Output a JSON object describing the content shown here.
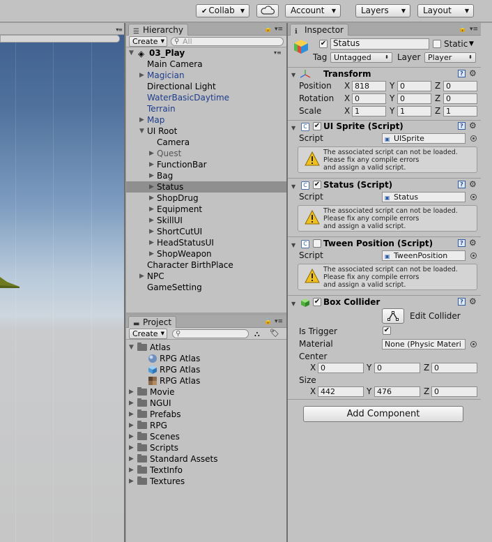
{
  "toolbar": {
    "collab": "Collab",
    "account": "Account",
    "layers": "Layers",
    "layout": "Layout"
  },
  "hierarchy": {
    "tab": "Hierarchy",
    "create": "Create",
    "search_placeholder": "All",
    "scene": "03_Play",
    "items": [
      {
        "label": "Main Camera"
      },
      {
        "label": "Magician"
      },
      {
        "label": "Directional Light"
      },
      {
        "label": "WaterBasicDaytime"
      },
      {
        "label": "Terrain"
      },
      {
        "label": "Map"
      },
      {
        "label": "UI Root"
      },
      {
        "label": "Camera"
      },
      {
        "label": "Quest"
      },
      {
        "label": "FunctionBar"
      },
      {
        "label": "Bag"
      },
      {
        "label": "Status"
      },
      {
        "label": "ShopDrug"
      },
      {
        "label": "Equipment"
      },
      {
        "label": "SkillUI"
      },
      {
        "label": "ShortCutUI"
      },
      {
        "label": "HeadStatusUI"
      },
      {
        "label": "ShopWeapon"
      },
      {
        "label": "Character BirthPlace"
      },
      {
        "label": "NPC"
      },
      {
        "label": "GameSetting"
      }
    ]
  },
  "project": {
    "tab": "Project",
    "create": "Create",
    "items": [
      {
        "label": "Atlas"
      },
      {
        "label": "RPG Atlas"
      },
      {
        "label": "RPG Atlas"
      },
      {
        "label": "RPG Atlas"
      },
      {
        "label": "Movie"
      },
      {
        "label": "NGUI"
      },
      {
        "label": "Prefabs"
      },
      {
        "label": "RPG"
      },
      {
        "label": "Scenes"
      },
      {
        "label": "Scripts"
      },
      {
        "label": "Standard Assets"
      },
      {
        "label": "TextInfo"
      },
      {
        "label": "Textures"
      }
    ]
  },
  "inspector": {
    "tab": "Inspector",
    "name": "Status",
    "static_label": "Static",
    "tag_label": "Tag",
    "tag_value": "Untagged",
    "layer_label": "Layer",
    "layer_value": "Player",
    "transform": {
      "title": "Transform",
      "position_label": "Position",
      "rotation_label": "Rotation",
      "scale_label": "Scale",
      "position": {
        "x": "818",
        "y": "0",
        "z": "0"
      },
      "rotation": {
        "x": "0",
        "y": "0",
        "z": "0"
      },
      "scale": {
        "x": "1",
        "y": "1",
        "z": "1"
      }
    },
    "axis": {
      "x": "X",
      "y": "Y",
      "z": "Z"
    },
    "script_label": "Script",
    "components": [
      {
        "title": "UI Sprite (Script)",
        "script": "UISprite"
      },
      {
        "title": "Status (Script)",
        "script": "Status"
      },
      {
        "title": "Tween Position (Script)",
        "script": "TweenPosition"
      }
    ],
    "warning": "The associated script can not be loaded.\nPlease fix any compile errors\nand assign a valid script.",
    "box_collider": {
      "title": "Box Collider",
      "edit_collider": "Edit Collider",
      "is_trigger_label": "Is Trigger",
      "material_label": "Material",
      "material_value": "None (Physic Materi",
      "center_label": "Center",
      "size_label": "Size",
      "center": {
        "x": "0",
        "y": "0",
        "z": "0"
      },
      "size": {
        "x": "442",
        "y": "476",
        "z": "0"
      }
    },
    "add_component": "Add Component"
  }
}
